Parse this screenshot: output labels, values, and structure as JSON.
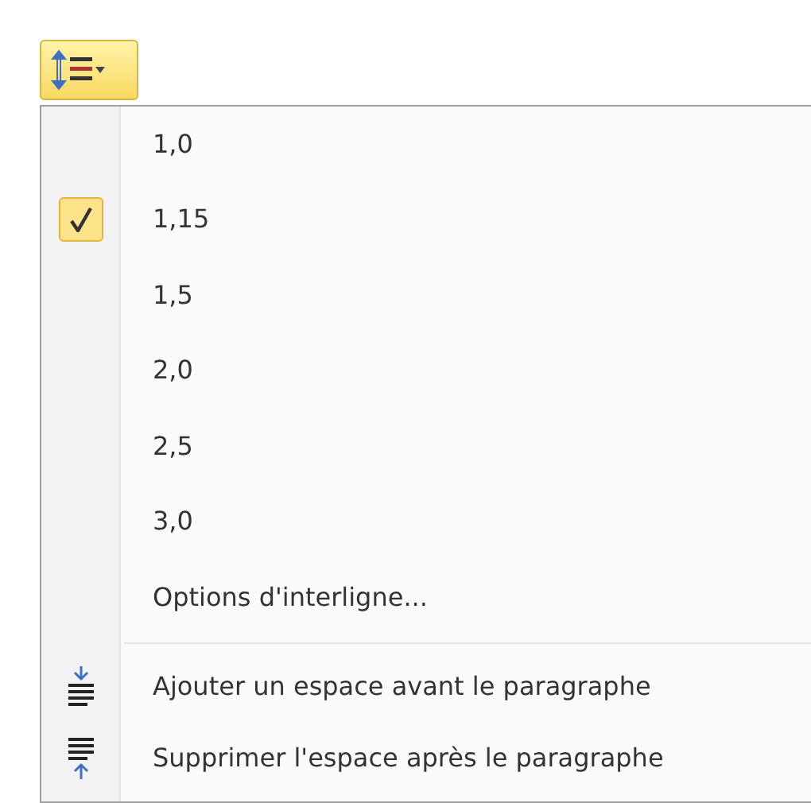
{
  "toolbar_button": {
    "expanded": true
  },
  "menu": {
    "items": [
      {
        "kind": "spacing",
        "label": "1,0",
        "selected": false
      },
      {
        "kind": "spacing",
        "label": "1,15",
        "selected": true
      },
      {
        "kind": "spacing",
        "label": "1,5",
        "selected": false
      },
      {
        "kind": "spacing",
        "label": "2,0",
        "selected": false
      },
      {
        "kind": "spacing",
        "label": "2,5",
        "selected": false
      },
      {
        "kind": "spacing",
        "label": "3,0",
        "selected": false
      },
      {
        "kind": "command",
        "label": "Options d'interligne..."
      },
      {
        "kind": "space-before",
        "label": "Ajouter un espace avant le paragraphe"
      },
      {
        "kind": "space-after",
        "label": "Supprimer l'espace après le paragraphe"
      }
    ]
  }
}
